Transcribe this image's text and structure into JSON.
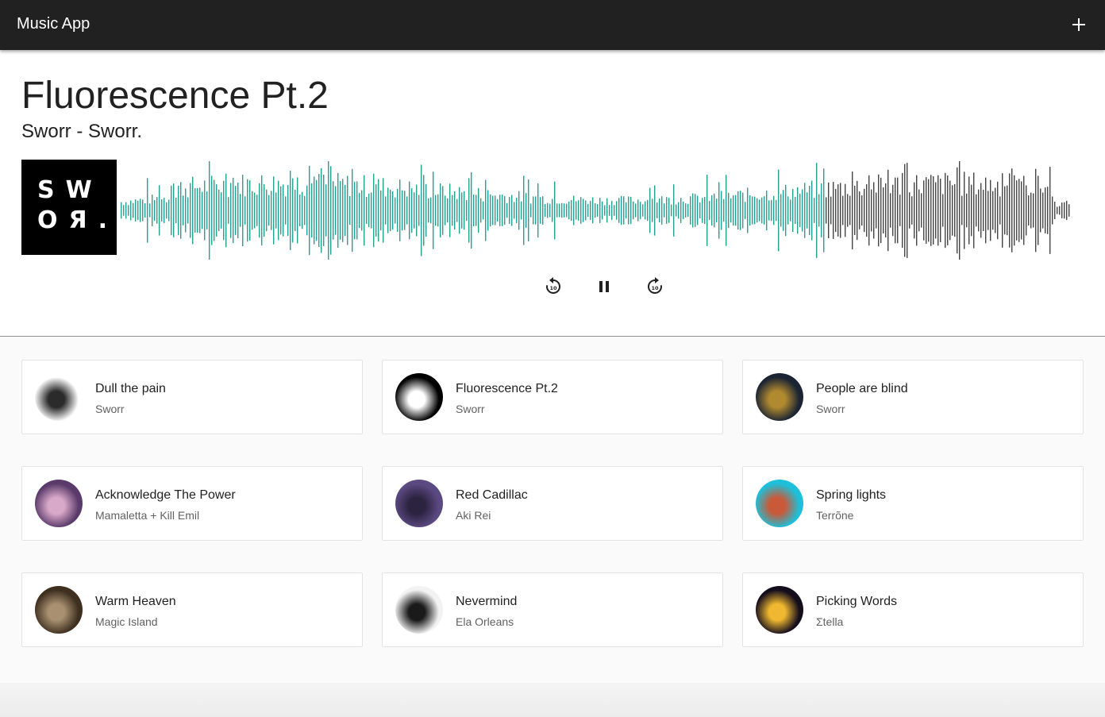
{
  "app": {
    "title": "Music App",
    "add_icon": "plus-icon"
  },
  "player": {
    "title": "Fluorescence Pt.2",
    "subtitle": "Sworr - Sworr.",
    "cover_lines": [
      "SW",
      "OЯ."
    ],
    "progress": 0.74,
    "colors": {
      "played": "#26a091",
      "unplayed": "#444444"
    },
    "controls": {
      "rewind_icon": "replay-10-icon",
      "pause_icon": "pause-icon",
      "forward_icon": "forward-10-icon",
      "rewind_label": "10",
      "forward_label": "10"
    }
  },
  "tracks": [
    {
      "title": "Dull the pain",
      "artist": "Sworr",
      "art_colors": [
        "#ffffff",
        "#2b2b2b"
      ]
    },
    {
      "title": "Fluorescence Pt.2",
      "artist": "Sworr",
      "art_colors": [
        "#000000",
        "#ffffff"
      ]
    },
    {
      "title": "People are blind",
      "artist": "Sworr",
      "art_colors": [
        "#1b2433",
        "#b18a2f"
      ]
    },
    {
      "title": "Acknowledge The Power",
      "artist": "Mamaletta + Kill Emil",
      "art_colors": [
        "#5a3a6a",
        "#d9a9c9"
      ]
    },
    {
      "title": "Red Cadillac",
      "artist": "Aki Rei",
      "art_colors": [
        "#5b4a82",
        "#2b2340"
      ]
    },
    {
      "title": "Spring lights",
      "artist": "Terrõne",
      "art_colors": [
        "#1ebfd8",
        "#c85a3a"
      ]
    },
    {
      "title": "Warm Heaven",
      "artist": "Magic Island",
      "art_colors": [
        "#3e2f1f",
        "#a89070"
      ]
    },
    {
      "title": "Nevermind",
      "artist": "Ela Orleans",
      "art_colors": [
        "#f2f2f2",
        "#1a1a1a"
      ]
    },
    {
      "title": "Picking Words",
      "artist": "Σtella",
      "art_colors": [
        "#140d1c",
        "#f0b830"
      ]
    }
  ]
}
